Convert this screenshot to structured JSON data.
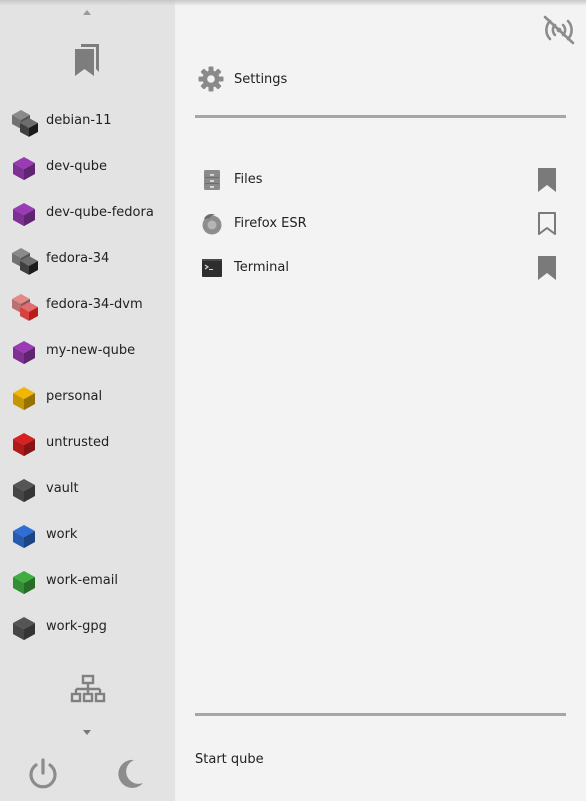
{
  "sidebar": {
    "qubes": [
      {
        "label": "debian-11",
        "icon": "qube-template-gray-icon",
        "color": "#8a8a8a",
        "dark": "#1e1e1e",
        "selected": true
      },
      {
        "label": "dev-qube",
        "icon": "qube-purple-icon",
        "color": "#9a3bb5"
      },
      {
        "label": "dev-qube-fedora",
        "icon": "qube-purple-icon",
        "color": "#9a3bb5"
      },
      {
        "label": "fedora-34",
        "icon": "qube-template-gray-icon",
        "color": "#8a8a8a",
        "dark": "#1e1e1e"
      },
      {
        "label": "fedora-34-dvm",
        "icon": "qube-dispvm-red-icon",
        "color": "#e28a8a",
        "dark": "#d02020"
      },
      {
        "label": "my-new-qube",
        "icon": "qube-purple-icon",
        "color": "#9a3bb5"
      },
      {
        "label": "personal",
        "icon": "qube-yellow-icon",
        "color": "#f2b705"
      },
      {
        "label": "untrusted",
        "icon": "qube-red-icon",
        "color": "#d92020"
      },
      {
        "label": "vault",
        "icon": "qube-black-icon",
        "color": "#555555"
      },
      {
        "label": "work",
        "icon": "qube-blue-icon",
        "color": "#2e6fd6"
      },
      {
        "label": "work-email",
        "icon": "qube-green-icon",
        "color": "#3fae3f"
      },
      {
        "label": "work-gpg",
        "icon": "qube-black-icon",
        "color": "#555555"
      }
    ]
  },
  "main": {
    "settings_label": "Settings",
    "apps": [
      {
        "label": "Files",
        "icon": "file-cabinet-icon",
        "bookmarked": true
      },
      {
        "label": "Firefox ESR",
        "icon": "firefox-icon",
        "bookmarked": false
      },
      {
        "label": "Terminal",
        "icon": "terminal-icon",
        "bookmarked": true
      }
    ],
    "start_qube_label": "Start qube"
  }
}
